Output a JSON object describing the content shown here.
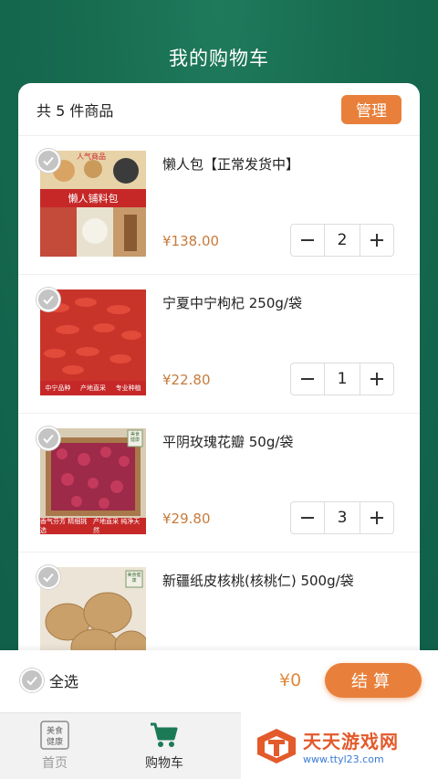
{
  "page": {
    "title": "我的购物车"
  },
  "cart": {
    "count_text": "共 5 件商品",
    "manage_label": "管理",
    "items": [
      {
        "title": "懒人包【正常发货中】",
        "price": "¥138.00",
        "qty": "2",
        "image_caption": "懒人铺料包",
        "image_tag": "人气商品"
      },
      {
        "title": "宁夏中宁枸杞 250g/袋",
        "price": "¥22.80",
        "qty": "1",
        "image_badges": [
          "中宁品种 黄金糖份",
          "产地直采 生态天然",
          "专业种植 精选晒",
          "中宁品种",
          "产地直采",
          "专业种植"
        ]
      },
      {
        "title": "平阴玫瑰花瓣 50g/袋",
        "price": "¥29.80",
        "qty": "3",
        "image_badges": [
          "香气芬芳 精细挑选",
          "产地直采 纯净天然"
        ],
        "image_stamp": "美食健康"
      },
      {
        "title": "新疆纸皮核桃(核桃仁) 500g/袋",
        "price": "",
        "qty": "",
        "image_stamp": "美食健康"
      }
    ]
  },
  "bottom_bar": {
    "select_all_label": "全选",
    "total": "¥0",
    "checkout_label": "结算"
  },
  "tabbar": {
    "tabs": [
      {
        "label": "首页",
        "icon": "meishi-jiankang-logo-icon",
        "active": false
      },
      {
        "label": "购物车",
        "icon": "cart-icon",
        "active": true
      }
    ]
  },
  "watermark": {
    "main": "天天游戏网",
    "sub": "www.ttyl23.com"
  },
  "colors": {
    "header_green": "#176b4f",
    "accent_orange": "#e8803b",
    "price_color": "#c77b3c",
    "active_tab_green": "#1b7a55"
  }
}
